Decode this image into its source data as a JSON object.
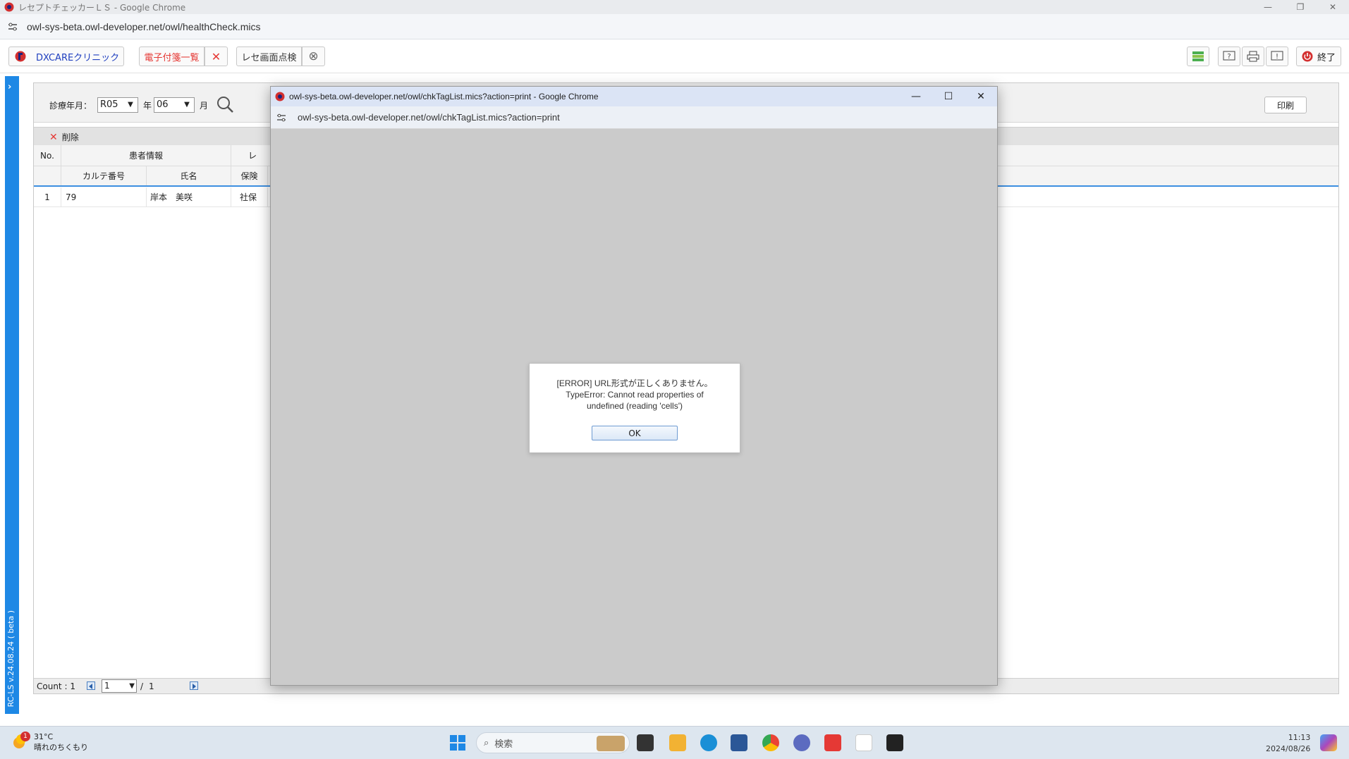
{
  "browser": {
    "window_title": "レセプトチェッカーＬＳ - Google Chrome",
    "url": "owl-sys-beta.owl-developer.net/owl/healthCheck.mics"
  },
  "toolbar": {
    "clinic_label": "DXCAREクリニック",
    "tabs": [
      {
        "label": "電子付箋一覧",
        "active": true
      },
      {
        "label": "レセ画面点検",
        "active": false
      }
    ],
    "exit_label": "終了"
  },
  "sidebar": {
    "version": "RC-LS v.24.08.24 ( beta )"
  },
  "search": {
    "label": "診療年月：",
    "era_value": "R05",
    "year_unit": "年",
    "month_value": "06",
    "month_unit": "月",
    "print_label": "印刷"
  },
  "actions": {
    "delete_label": "削除"
  },
  "table": {
    "header_top": {
      "no": "No.",
      "patient_group": "患者情報",
      "partial": "レ"
    },
    "header_sub": {
      "chart_no": "カルテ番号",
      "name": "氏名",
      "insurance": "保険"
    },
    "rows": [
      {
        "no": "1",
        "chart_no": "79",
        "name": "岸本　美咲",
        "insurance": "社保"
      }
    ]
  },
  "footer": {
    "count_label": "Count :",
    "count_value": "1",
    "page_value": "1",
    "page_sep": "/",
    "page_total": "1"
  },
  "popup": {
    "title": "owl-sys-beta.owl-developer.net/owl/chkTagList.mics?action=print - Google Chrome",
    "url": "owl-sys-beta.owl-developer.net/owl/chkTagList.mics?action=print",
    "dialog": {
      "line1": "[ERROR] URL形式が正しくありません。",
      "line2": "TypeError: Cannot read properties of",
      "line3": "undefined (reading 'cells')",
      "ok_label": "OK"
    }
  },
  "taskbar": {
    "temp": "31°C",
    "weather": "晴れのちくもり",
    "weather_badge": "1",
    "search_placeholder": "検索",
    "time": "11:13",
    "date": "2024/08/26"
  },
  "colors": {
    "accent": "#1e88e5",
    "tab_active": "#e53935",
    "clinic_text": "#1f3fbf"
  }
}
